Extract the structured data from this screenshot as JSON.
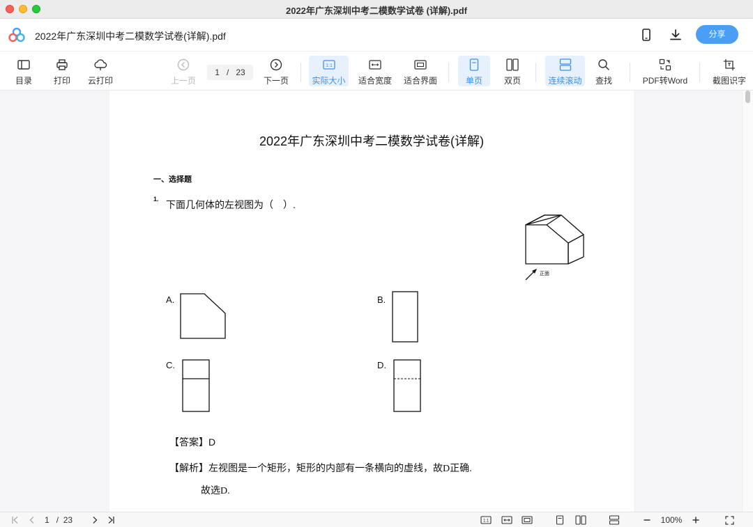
{
  "window": {
    "title": "2022年广东深圳中考二模数学试卷 (详解).pdf"
  },
  "header": {
    "doc_name": "2022年广东深圳中考二模数学试卷(详解).pdf",
    "share_label": "分享",
    "icons": [
      "app-logo-icon",
      "phone-icon",
      "download-icon"
    ]
  },
  "toolbar": {
    "toc": "目录",
    "print": "打印",
    "cloud_print": "云打印",
    "prev_page": "上一页",
    "page_current": "1",
    "page_sep": "/",
    "page_total": "23",
    "next_page": "下一页",
    "actual_size": "实际大小",
    "fit_width": "适合宽度",
    "fit_page": "适合界面",
    "single_page": "单页",
    "double_page": "双页",
    "continuous_scroll": "连续滚动",
    "find": "查找",
    "pdf_to_word": "PDF转Word",
    "screenshot_ocr": "截图识字",
    "accent_color": "#3d8fe8"
  },
  "document": {
    "title": "2022年广东深圳中考二模数学试卷(详解)",
    "section": "一、选择题",
    "question_number": "1.",
    "question_text": "下面几何体的左视图为（　）.",
    "front_label": "正面",
    "options": {
      "a": "A.",
      "b": "B.",
      "c": "C.",
      "d": "D."
    },
    "answer": "【答案】D",
    "analysis": "【解析】左视图是一个矩形，矩形的内部有一条横向的虚线，故D正确.",
    "choose": "故选D."
  },
  "statusbar": {
    "page_current": "1",
    "page_sep": "/",
    "page_total": "23",
    "zoom": "100%"
  }
}
